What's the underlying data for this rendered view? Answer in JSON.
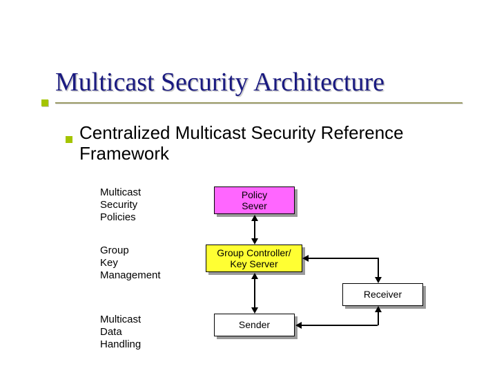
{
  "title": "Multicast Security Architecture",
  "subhead": "Centralized Multicast Security Reference Framework",
  "rows": {
    "policies": {
      "label": "Multicast\nSecurity\nPolicies"
    },
    "keymgmt": {
      "label": "Group\nKey\nManagement"
    },
    "data": {
      "label": "Multicast\nData\nHandling"
    }
  },
  "boxes": {
    "policy_server": {
      "text": "Policy\nSever"
    },
    "group_controller": {
      "text": "Group Controller/\nKey Server"
    },
    "sender": {
      "text": "Sender"
    },
    "receiver": {
      "text": "Receiver"
    }
  }
}
